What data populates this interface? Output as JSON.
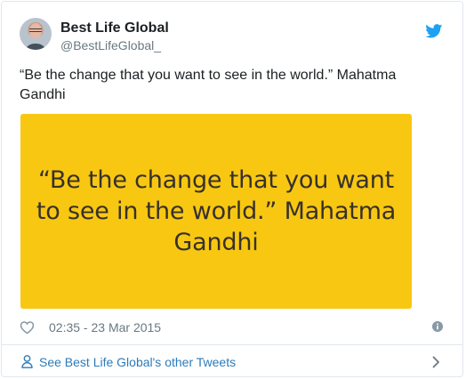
{
  "author": {
    "name": "Best Life Global",
    "handle": "@BestLifeGlobal_"
  },
  "tweet": {
    "text_line1": "“Be the change that you want to see in the world.”  Mahatma",
    "text_line2": "Gandhi",
    "image_quote_lines": [
      "“Be the change that you want",
      "to see in the world.” Mahatma",
      "Gandhi"
    ],
    "timestamp": "02:35 - 23 Mar 2015"
  },
  "footer": {
    "other_tweets_label": "See Best Life Global's other Tweets"
  },
  "icons": {
    "brand": "twitter-icon",
    "like": "heart-icon",
    "info": "info-icon",
    "profile": "person-icon",
    "more": "chevron-right-icon"
  },
  "colors": {
    "image_background": "#f8c712",
    "twitter_blue": "#1da1f2",
    "link_blue": "#2b7bb9",
    "muted_text": "#697882"
  }
}
